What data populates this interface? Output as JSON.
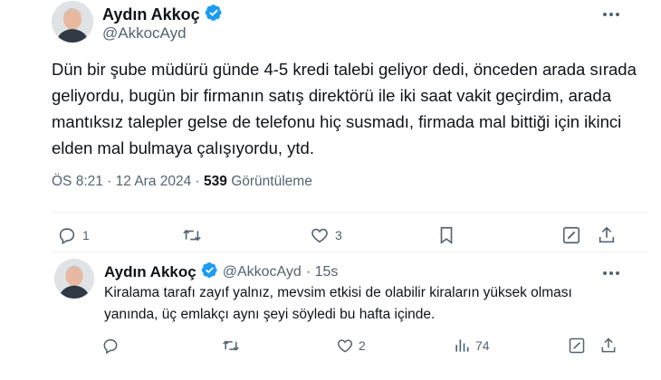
{
  "main_post": {
    "author_name": "Aydın Akkoç",
    "author_handle": "@AkkocAyd",
    "text": "Dün bir şube müdürü günde 4-5 kredi talebi geliyor dedi, önceden arada sırada geliyordu, bugün bir firmanın satış direktörü ile iki saat vakit geçirdim, arada mantıksız talepler gelse de telefonu hiç susmadı, firmada mal bittiği için ikinci elden mal bulmaya çalışıyordu, ytd.",
    "time": "ÖS 8:21 · 12 Ara 2024 ·",
    "views_count": "539",
    "views_label": "Görüntüleme",
    "actions": {
      "replies": "1",
      "reposts": "",
      "likes": "3"
    }
  },
  "reply_post": {
    "author_name": "Aydın Akkoç",
    "author_handle": "@AkkocAyd",
    "time": "· 15s",
    "text": "Kiralama tarafı zayıf yalnız, mevsim etkisi de olabilir kiraların yüksek olması yanında, üç emlakçı aynı şeyi söyledi bu hafta içinde.",
    "actions": {
      "replies": "",
      "reposts": "",
      "likes": "2",
      "views": "74"
    }
  },
  "colors": {
    "verified": "#1d9bf0",
    "text_primary": "#0f1419",
    "text_secondary": "#536471",
    "divider": "#eff3f4"
  },
  "icons": [
    "verified-badge-icon",
    "more-icon",
    "reply-icon",
    "repost-icon",
    "like-icon",
    "bookmark-icon",
    "share-icon",
    "edit-icon",
    "views-icon"
  ]
}
